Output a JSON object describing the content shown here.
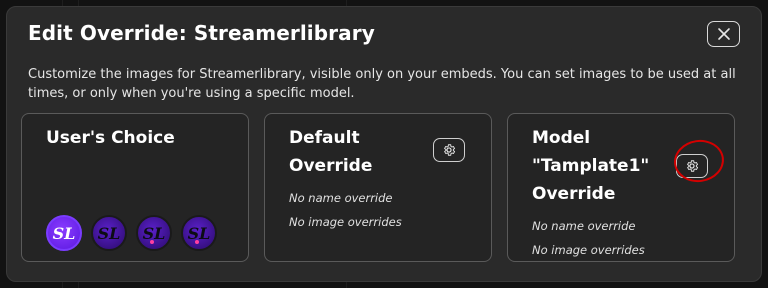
{
  "dialog": {
    "title": "Edit Override: Streamerlibrary",
    "description": "Customize the images for Streamerlibrary, visible only on your embeds. You can set images to be used at all times, or only when you're using a specific model."
  },
  "cards": {
    "users_choice": {
      "title": "User's Choice",
      "avatars": [
        "SL",
        "SL",
        "SL",
        "SL"
      ]
    },
    "default_override": {
      "title": "Default Override",
      "name_hint": "No name override",
      "image_hint": "No image overrides"
    },
    "model_override": {
      "title": "Model \"Tamplate1\" Override",
      "name_hint": "No name override",
      "image_hint": "No image overrides"
    }
  },
  "icons": {
    "close": "close-icon",
    "gear": "gear-icon"
  },
  "colors": {
    "modal_bg": "#2a2a2a",
    "annotation_circle": "#d40000",
    "avatar_purple": "#5a18e0"
  }
}
